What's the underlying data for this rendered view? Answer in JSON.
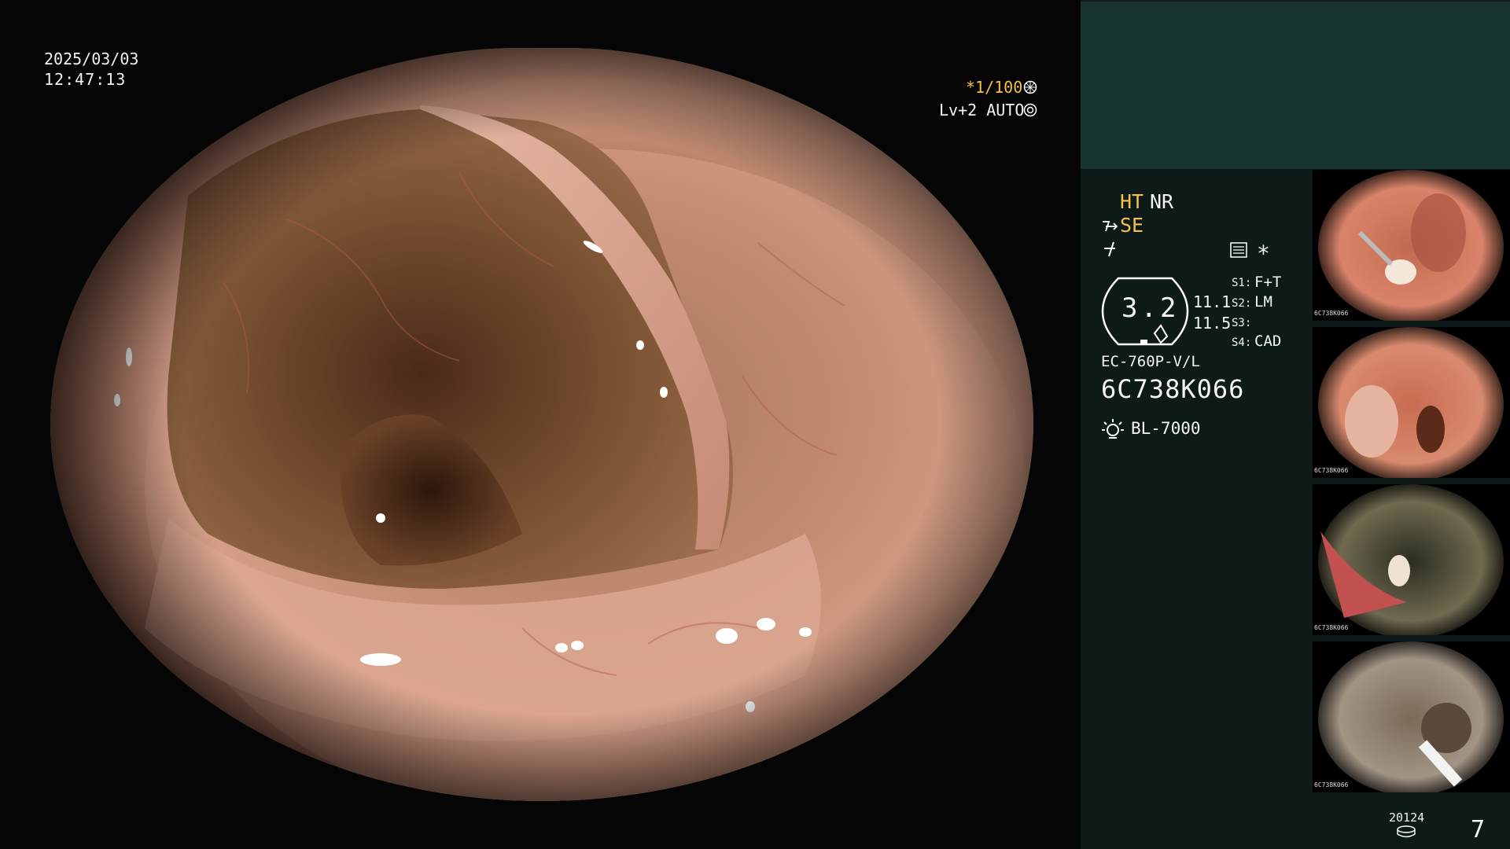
{
  "overlay": {
    "date": "2025/03/03",
    "time": "12:47:13",
    "shutter": "*1/100",
    "level": "Lv+2 AUTO"
  },
  "panel": {
    "mode_ht": "HT",
    "mode_nr": "NR",
    "mode_se": "SE",
    "scale_value": "3.2",
    "scale_a": "11.1",
    "scale_b": "11.5",
    "s1": "S1:",
    "s1_val": "F+T",
    "s2": "S2:",
    "s2_val": "LM",
    "s3": "S3:",
    "s3_val": "",
    "s4": "S4:",
    "s4_val": "CAD",
    "asterisk": "*",
    "scope_model": "EC-760P-V/L",
    "scope_serial": "6C738K066",
    "light_source": "BL-7000",
    "counter_label": "20124",
    "page_number": "7"
  },
  "thumbnails": [
    {
      "id": "6C738K066"
    },
    {
      "id": "6C738K066"
    },
    {
      "id": "6C738K066"
    },
    {
      "id": "6C738K066"
    }
  ],
  "icons": [
    "aperture-icon",
    "iris-icon",
    "scope-angle-icon",
    "freeze-icon",
    "settings-list-icon",
    "light-bulb-icon",
    "disk-icon"
  ],
  "colors": {
    "panel_bg": "#0e1a19",
    "panel_top": "#17332f",
    "accent_yellow": "#f2c24a"
  }
}
